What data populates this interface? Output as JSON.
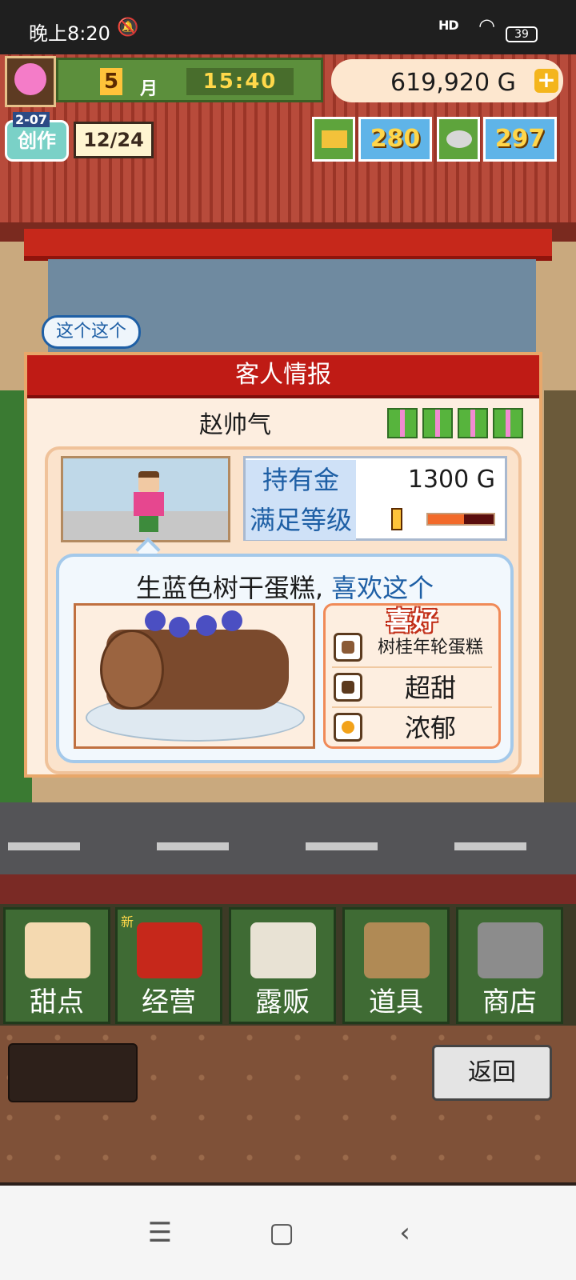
{
  "status_bar": {
    "time": "晚上8:20",
    "network": "HD",
    "battery": "39"
  },
  "hud": {
    "month_number": "5",
    "month_unit": "月",
    "clock": "15:40",
    "money": "619,920 G",
    "create_level": "2-07",
    "create_label": "创作",
    "create_count": "12/24",
    "resource_gold": "280",
    "resource_silver": "297"
  },
  "bubble": "这个这个",
  "dialog": {
    "title": "客人情报",
    "customer_name": "赵帅气",
    "money_label": "持有金",
    "money_value": "1300 G",
    "satisfaction_label": "满足等级",
    "satisfaction_fraction": 0.55,
    "speech_main": "生蓝色树干蛋糕,",
    "speech_highlight": " 喜欢这个",
    "preferences_title": "喜好",
    "preferences": [
      "树桂年轮蛋糕",
      "超甜",
      "浓郁"
    ]
  },
  "menu": {
    "new_tag": "新",
    "items": [
      "甜点",
      "经营",
      "露贩",
      "道具",
      "商店"
    ]
  },
  "back_button": "返回",
  "nav": {
    "menu": "☰",
    "home": "▢",
    "back": "‹"
  },
  "colors": {
    "dialog_title": "#bf1b15",
    "menu_green": "#3f6b34",
    "accent_blue": "#1e5fa5"
  }
}
